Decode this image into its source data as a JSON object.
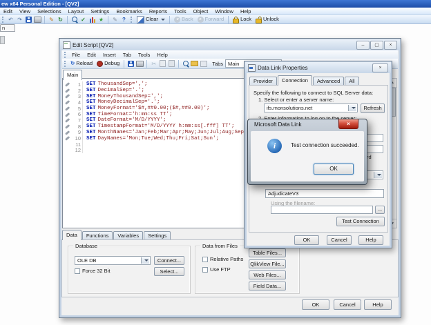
{
  "app": {
    "title": "ew x64 Personal Edition - [QV2]",
    "menus": [
      "Edit",
      "View",
      "Selections",
      "Layout",
      "Settings",
      "Bookmarks",
      "Reports",
      "Tools",
      "Object",
      "Window",
      "Help"
    ],
    "toolbar": {
      "clear": "Clear",
      "back": "Back",
      "forward": "Forward",
      "lock": "Lock",
      "unlock": "Unlock"
    },
    "sheet_tab_fragment": "n"
  },
  "icons": {
    "undo": "↶",
    "redo": "↷",
    "edit": "✎",
    "check": "✓",
    "star": "★",
    "help": "?",
    "cut": "✂",
    "reload": "↻",
    "min": "–",
    "max": "▢",
    "close": "×",
    "up": "▲",
    "down": "▼"
  },
  "edit_script": {
    "title": "Edit Script [QV2]",
    "menus": [
      "File",
      "Edit",
      "Insert",
      "Tab",
      "Tools",
      "Help"
    ],
    "toolbar": {
      "reload": "Reload",
      "debug": "Debug",
      "tabs_label": "Tabs",
      "tab_value": "Main"
    },
    "script_tab": "Main",
    "lines": [
      {
        "num": "1",
        "kw": "SET",
        "code": "ThousandSep=',';"
      },
      {
        "num": "2",
        "kw": "SET",
        "code": "DecimalSep='.';"
      },
      {
        "num": "3",
        "kw": "SET",
        "code": "MoneyThousandSep=',';"
      },
      {
        "num": "4",
        "kw": "SET",
        "code": "MoneyDecimalSep='.';"
      },
      {
        "num": "5",
        "kw": "SET",
        "code": "MoneyFormat='$#,##0.00;($#,##0.00)';"
      },
      {
        "num": "6",
        "kw": "SET",
        "code": "TimeFormat='h:mm:ss TT';"
      },
      {
        "num": "7",
        "kw": "SET",
        "code": "DateFormat='M/D/YYYY';"
      },
      {
        "num": "8",
        "kw": "SET",
        "code": "TimestampFormat='M/D/YYYY h:mm:ss[.fff] TT';"
      },
      {
        "num": "9",
        "kw": "SET",
        "code": "MonthNames='Jan;Feb;Mar;Apr;May;Jun;Jul;Aug;Sep;Oct"
      },
      {
        "num": "10",
        "kw": "SET",
        "code": "DayNames='Mon;Tue;Wed;Thu;Fri;Sat;Sun';"
      },
      {
        "num": "11",
        "kw": "",
        "code": ""
      },
      {
        "num": "12",
        "kw": "",
        "code": ""
      }
    ],
    "bottom_tabs": [
      "Data",
      "Functions",
      "Variables",
      "Settings"
    ],
    "database": {
      "label": "Database",
      "driver": "OLE DB",
      "connect": "Connect...",
      "force32": "Force 32 Bit",
      "select": "Select..."
    },
    "files": {
      "label": "Data from Files",
      "relative": "Relative Paths",
      "ftp": "Use FTP",
      "table": "Table Files...",
      "qlikview": "QlikView File...",
      "web": "Web Files...",
      "field": "Field Data..."
    },
    "buttons": {
      "ok": "OK",
      "cancel": "Cancel",
      "help": "Help"
    }
  },
  "dlp": {
    "title": "Data Link Properties",
    "tabs": [
      "Provider",
      "Connection",
      "Advanced",
      "All"
    ],
    "intro": "Specify the following to connect to SQL Server data:",
    "step1": "1. Select or enter a server name:",
    "server": "ifs.monsolutions.net",
    "refresh": "Refresh",
    "step2": "2. Enter information to log on to the server:",
    "fragment_rd": "rd",
    "database_value": "AdjudicateV3",
    "filename_label": "Using the filename:",
    "browse": "...",
    "test": "Test Connection",
    "buttons": {
      "ok": "OK",
      "cancel": "Cancel",
      "help": "Help"
    }
  },
  "msgbox": {
    "title": "Microsoft Data Link",
    "message": "Test connection succeeded.",
    "ok": "OK"
  }
}
